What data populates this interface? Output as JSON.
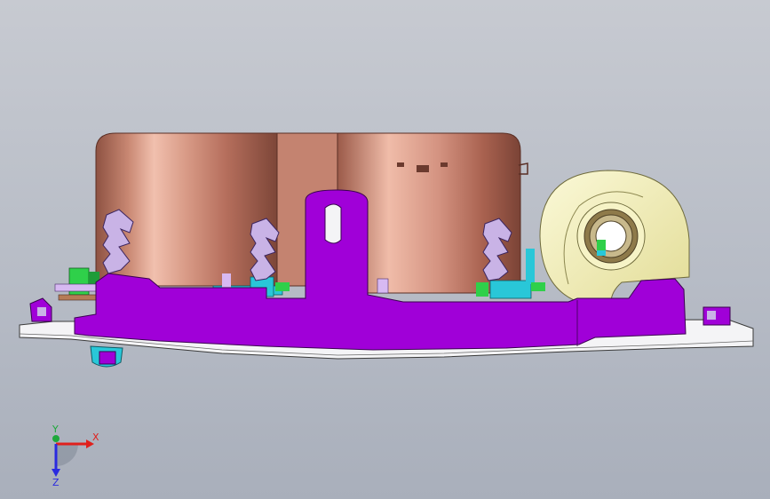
{
  "triad": {
    "x_label": "X",
    "y_label": "Y",
    "z_label": "Z"
  },
  "colors": {
    "background_top": "#c7cad1",
    "background_bottom": "#a9afbb",
    "copper_body": "#c98873",
    "copper_highlight": "#f1c0ae",
    "purple_frame": "#a000d8",
    "light_purple": "#c9b3e6",
    "white_base": "#f4f4f6",
    "yellow_coil": "#f3f0b8",
    "green_part": "#2fd04a",
    "cyan_part": "#29c7d8",
    "x_axis": "#e0201c",
    "y_axis": "#1ea83b",
    "z_axis": "#2a2ae0"
  }
}
